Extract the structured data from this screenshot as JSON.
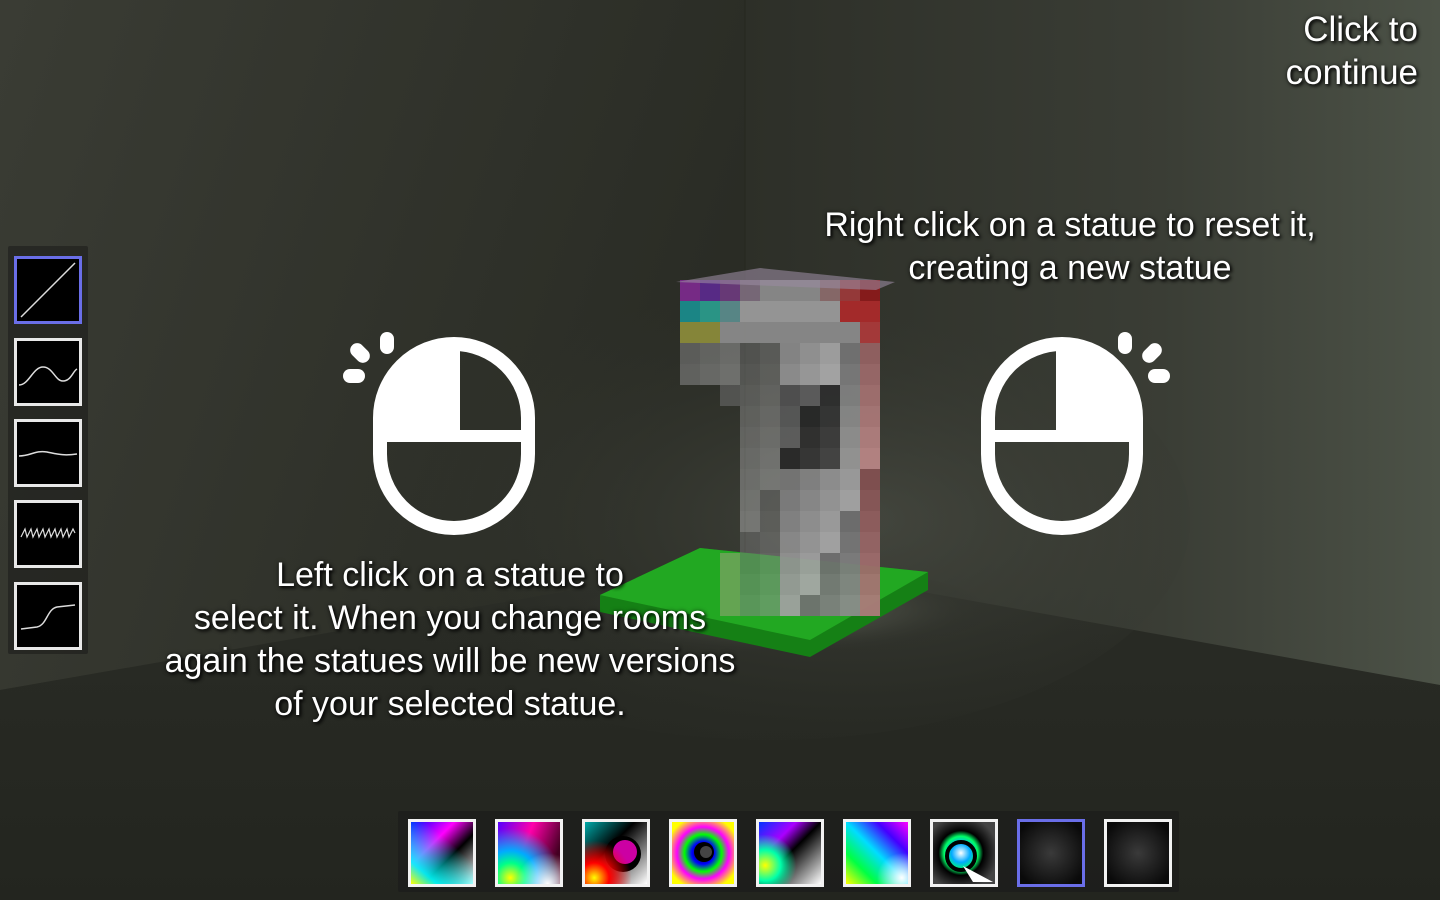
{
  "hud": {
    "continue_text": "Click to\ncontinue",
    "right_click_hint": "Right click on a statue to reset it,\ncreating a new statue",
    "left_click_hint": "Left click on a statue to\nselect it. When you change rooms\nagain the statues will be new versions\nof your selected statue."
  },
  "icons": {
    "left_mouse": "mouse-left-click-icon",
    "right_mouse": "mouse-right-click-icon"
  },
  "curves": {
    "selected_index": 0,
    "items": [
      "linear-curve-icon",
      "sine-wave-curve-icon",
      "gentle-wave-curve-icon",
      "noise-curve-icon",
      "step-curve-icon"
    ]
  },
  "palettes": {
    "selected_index": 7,
    "count": 9
  },
  "colors": {
    "selection_border": "#6a6ee8",
    "floor_plate": "#1fa01f"
  }
}
